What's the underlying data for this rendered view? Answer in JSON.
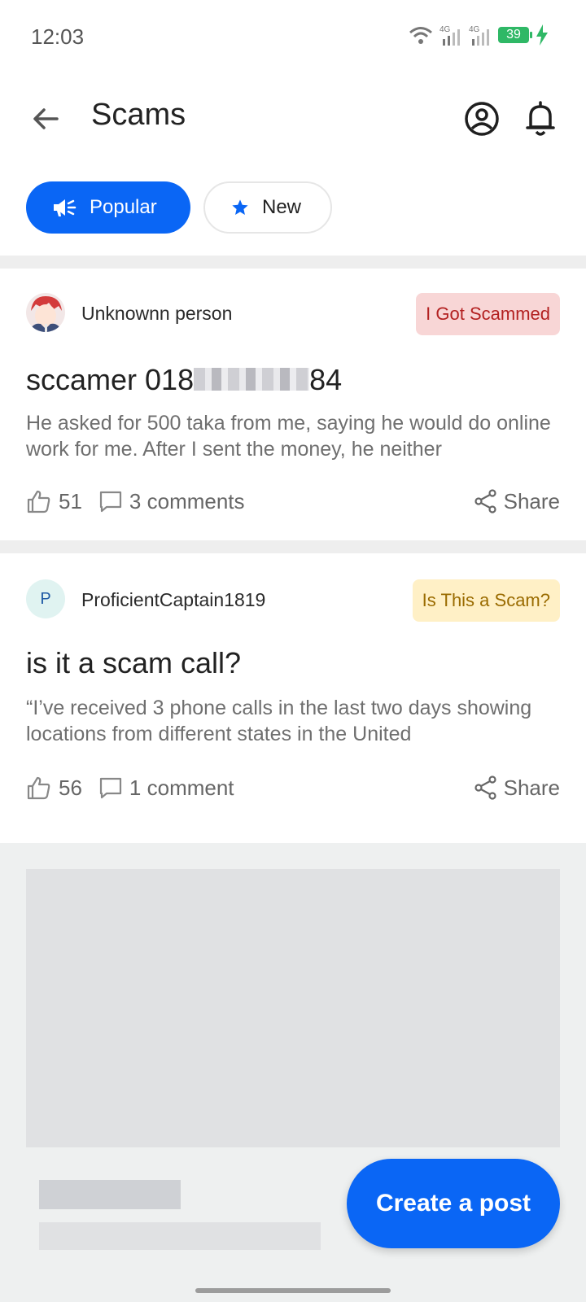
{
  "status_bar": {
    "time": "12:03",
    "network_1": "4G",
    "network_2": "4G",
    "battery_level": "39",
    "battery_color": "#2fb866"
  },
  "header": {
    "title": "Scams",
    "back_icon": "arrow-left-icon",
    "profile_icon": "account-circle-icon",
    "notification_icon": "bell-icon"
  },
  "filters": [
    {
      "label": "Popular",
      "icon": "megaphone-icon",
      "selected": true
    },
    {
      "label": "New",
      "icon": "star-icon",
      "selected": false
    }
  ],
  "posts": [
    {
      "author": "Unknownn person",
      "tag": "I Got Scammed",
      "title_prefix": "sccamer  018",
      "title_suffix": "84",
      "body": "He asked for 500 taka from me, saying he would do online work for me. After I sent the money, he neither",
      "likes": "51",
      "comments": "3 comments",
      "share": "Share"
    },
    {
      "author": "ProficientCaptain1819",
      "avatar_letter": "P",
      "tag": "Is This a Scam?",
      "title": "is it a scam call?",
      "body": "“I’ve received 3 phone calls in the last two days showing locations from different states in the United",
      "likes": "56",
      "comments": "1 comment",
      "share": "Share"
    }
  ],
  "fab": {
    "label": "Create a post"
  },
  "colors": {
    "accent": "#0a66f5",
    "tag_red_bg": "#f8d6d6",
    "tag_red_text": "#b32121",
    "tag_yellow_bg": "#fff0c6",
    "tag_yellow_text": "#9a6b00"
  }
}
